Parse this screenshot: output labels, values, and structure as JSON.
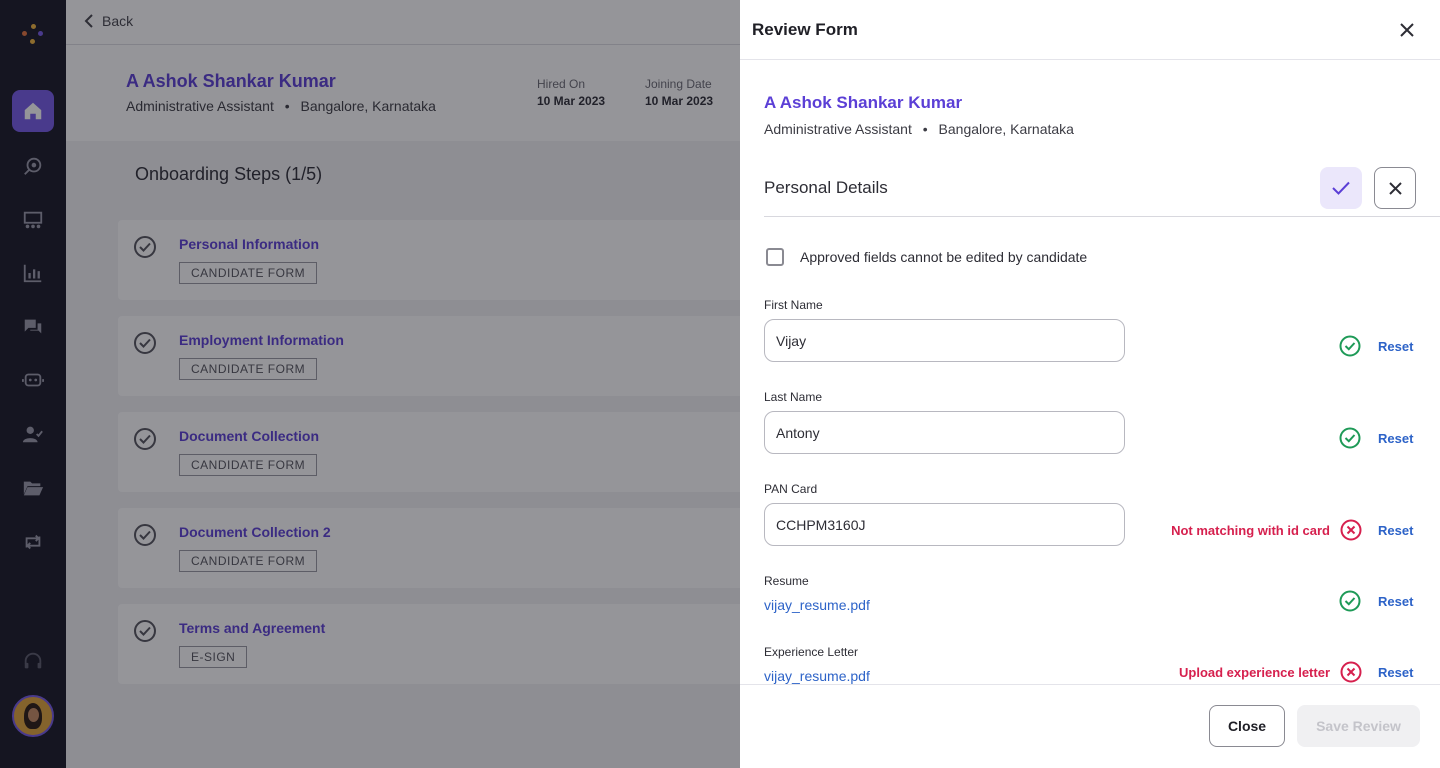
{
  "nav": {
    "back_label": "Back"
  },
  "candidate": {
    "name": "A Ashok Shankar Kumar",
    "role": "Administrative Assistant",
    "separator": "•",
    "location": "Bangalore, Karnataka",
    "hired_on_label": "Hired On",
    "hired_on_value": "10 Mar 2023",
    "joining_label": "Joining Date",
    "joining_value": "10 Mar 2023"
  },
  "onboarding": {
    "title": "Onboarding Steps (1/5)",
    "steps": [
      {
        "title": "Personal Information",
        "tag": "CANDIDATE FORM"
      },
      {
        "title": "Employment Information",
        "tag": "CANDIDATE FORM"
      },
      {
        "title": "Document Collection",
        "tag": "CANDIDATE FORM"
      },
      {
        "title": "Document Collection 2",
        "tag": "CANDIDATE FORM"
      },
      {
        "title": "Terms and Agreement",
        "tag": "E-SIGN"
      }
    ]
  },
  "drawer": {
    "title": "Review Form",
    "section_title": "Personal Details",
    "approve_checkbox_label": "Approved fields cannot be edited by candidate",
    "fields": {
      "first_name": {
        "label": "First Name",
        "value": "Vijay"
      },
      "last_name": {
        "label": "Last Name",
        "value": "Antony"
      },
      "pan_card": {
        "label": "PAN Card",
        "value": "CCHPM3160J",
        "error": "Not matching with id card"
      },
      "resume": {
        "label": "Resume",
        "value": "vijay_resume.pdf"
      },
      "experience": {
        "label": "Experience Letter",
        "value": "vijay_resume.pdf",
        "error": "Upload experience letter"
      }
    },
    "reset_label": "Reset",
    "close_button": "Close",
    "save_button": "Save Review"
  },
  "colors": {
    "accent": "#5b3fd6",
    "sidebar_bg": "#161625",
    "success": "#1e9a57",
    "error": "#d6204e",
    "link": "#2d63c8"
  },
  "icons": [
    "logo-icon",
    "home-icon",
    "sourcing-icon",
    "team-icon",
    "analytics-icon",
    "chat-icon",
    "bot-icon",
    "user-check-icon",
    "folder-icon",
    "transfer-icon",
    "headset-icon",
    "check-circle-icon",
    "error-circle-icon",
    "close-icon",
    "check-icon",
    "chevron-left-icon"
  ]
}
